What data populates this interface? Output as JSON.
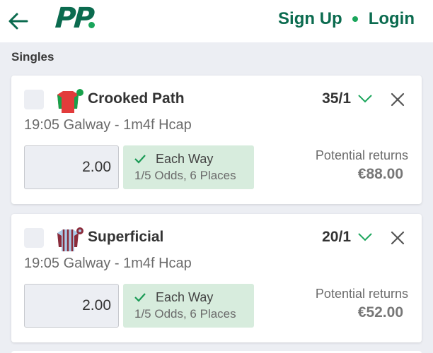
{
  "header": {
    "logo_text": "PP",
    "sign_up_label": "Sign Up",
    "login_label": "Login",
    "brand_color": "#0b6b4f",
    "accent_color": "#1aa55b"
  },
  "section": {
    "title": "Singles"
  },
  "bets": [
    {
      "horse": "Crooked Path",
      "odds": "35/1",
      "race": "19:05 Galway - 1m4f Hcap",
      "stake": "2.00",
      "each_way_label": "Each Way",
      "each_way_terms": "1/5 Odds, 6 Places",
      "returns_label": "Potential returns",
      "returns_value": "€88.00",
      "silk_colors": [
        "#e23b3b",
        "#18a14b"
      ]
    },
    {
      "horse": "Superficial",
      "odds": "20/1",
      "race": "19:05 Galway - 1m4f Hcap",
      "stake": "2.00",
      "each_way_label": "Each Way",
      "each_way_terms": "1/5 Odds, 6 Places",
      "returns_label": "Potential returns",
      "returns_value": "€52.00",
      "silk_colors": [
        "#a9cbe8",
        "#8b2b3a"
      ]
    }
  ]
}
